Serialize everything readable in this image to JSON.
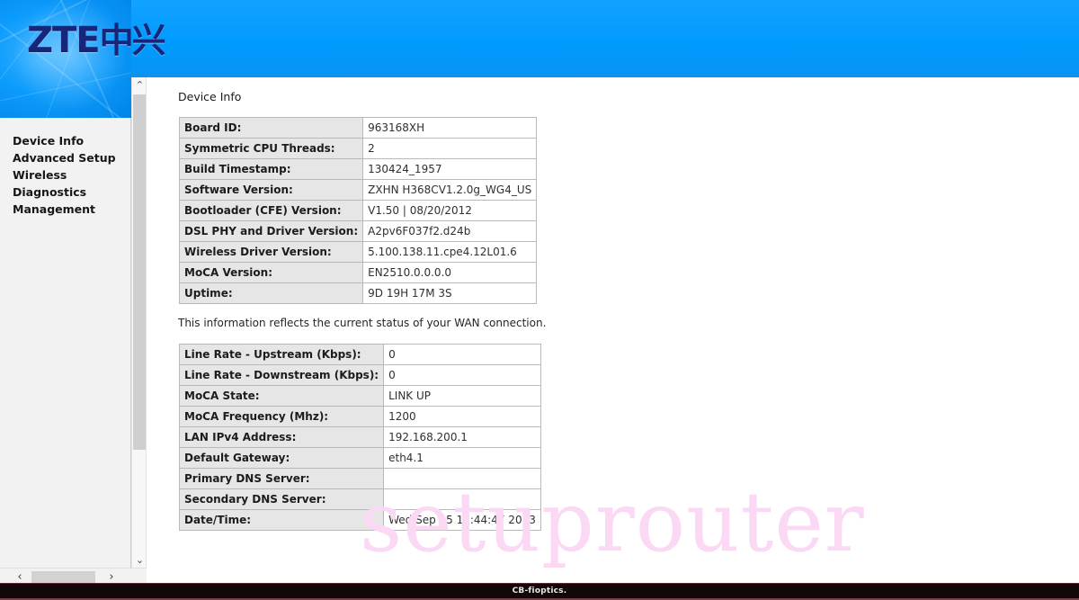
{
  "brand": {
    "logo_text": "ZTE",
    "logo_cjk": "中兴",
    "banner_color": "#0099ff",
    "logo_color": "#18267a"
  },
  "sidebar": {
    "items": [
      {
        "label": "Device Info"
      },
      {
        "label": "Advanced Setup"
      },
      {
        "label": "Wireless"
      },
      {
        "label": "Diagnostics"
      },
      {
        "label": "Management"
      }
    ]
  },
  "scrollbars": {
    "vertical_up": "⌃",
    "vertical_down": "⌄",
    "horizontal_left": "‹",
    "horizontal_right": "›"
  },
  "main": {
    "title": "Device Info",
    "device_table": {
      "rows": [
        {
          "label": "Board ID:",
          "value": "963168XH"
        },
        {
          "label": "Symmetric CPU Threads:",
          "value": "2"
        },
        {
          "label": "Build Timestamp:",
          "value": "130424_1957"
        },
        {
          "label": "Software Version:",
          "value": "ZXHN H368CV1.2.0g_WG4_US"
        },
        {
          "label": "Bootloader (CFE) Version:",
          "value": "V1.50 | 08/20/2012"
        },
        {
          "label": "DSL PHY and Driver Version:",
          "value": "A2pv6F037f2.d24b"
        },
        {
          "label": "Wireless Driver Version:",
          "value": "5.100.138.11.cpe4.12L01.6"
        },
        {
          "label": "MoCA Version:",
          "value": "EN2510.0.0.0.0"
        },
        {
          "label": "Uptime:",
          "value": "9D 19H 17M 3S"
        }
      ]
    },
    "wan_note": "This information reflects the current status of your WAN connection.",
    "wan_table": {
      "rows": [
        {
          "label": "Line Rate - Upstream (Kbps):",
          "value": "0"
        },
        {
          "label": "Line Rate - Downstream (Kbps):",
          "value": "0"
        },
        {
          "label": "MoCA State:",
          "value": "LINK UP"
        },
        {
          "label": "MoCA Frequency (Mhz):",
          "value": "1200"
        },
        {
          "label": "LAN IPv4 Address:",
          "value": "192.168.200.1"
        },
        {
          "label": "Default Gateway:",
          "value": "eth4.1"
        },
        {
          "label": "Primary DNS Server:",
          "value": ""
        },
        {
          "label": "Secondary DNS Server:",
          "value": ""
        },
        {
          "label": "Date/Time:",
          "value": "Wed Sep 25 11:44:47 2013"
        }
      ]
    }
  },
  "watermark": {
    "text": "setuprouter",
    "color": "#fbd9f4"
  },
  "bottom_bar": {
    "text": "CB-fioptics."
  }
}
